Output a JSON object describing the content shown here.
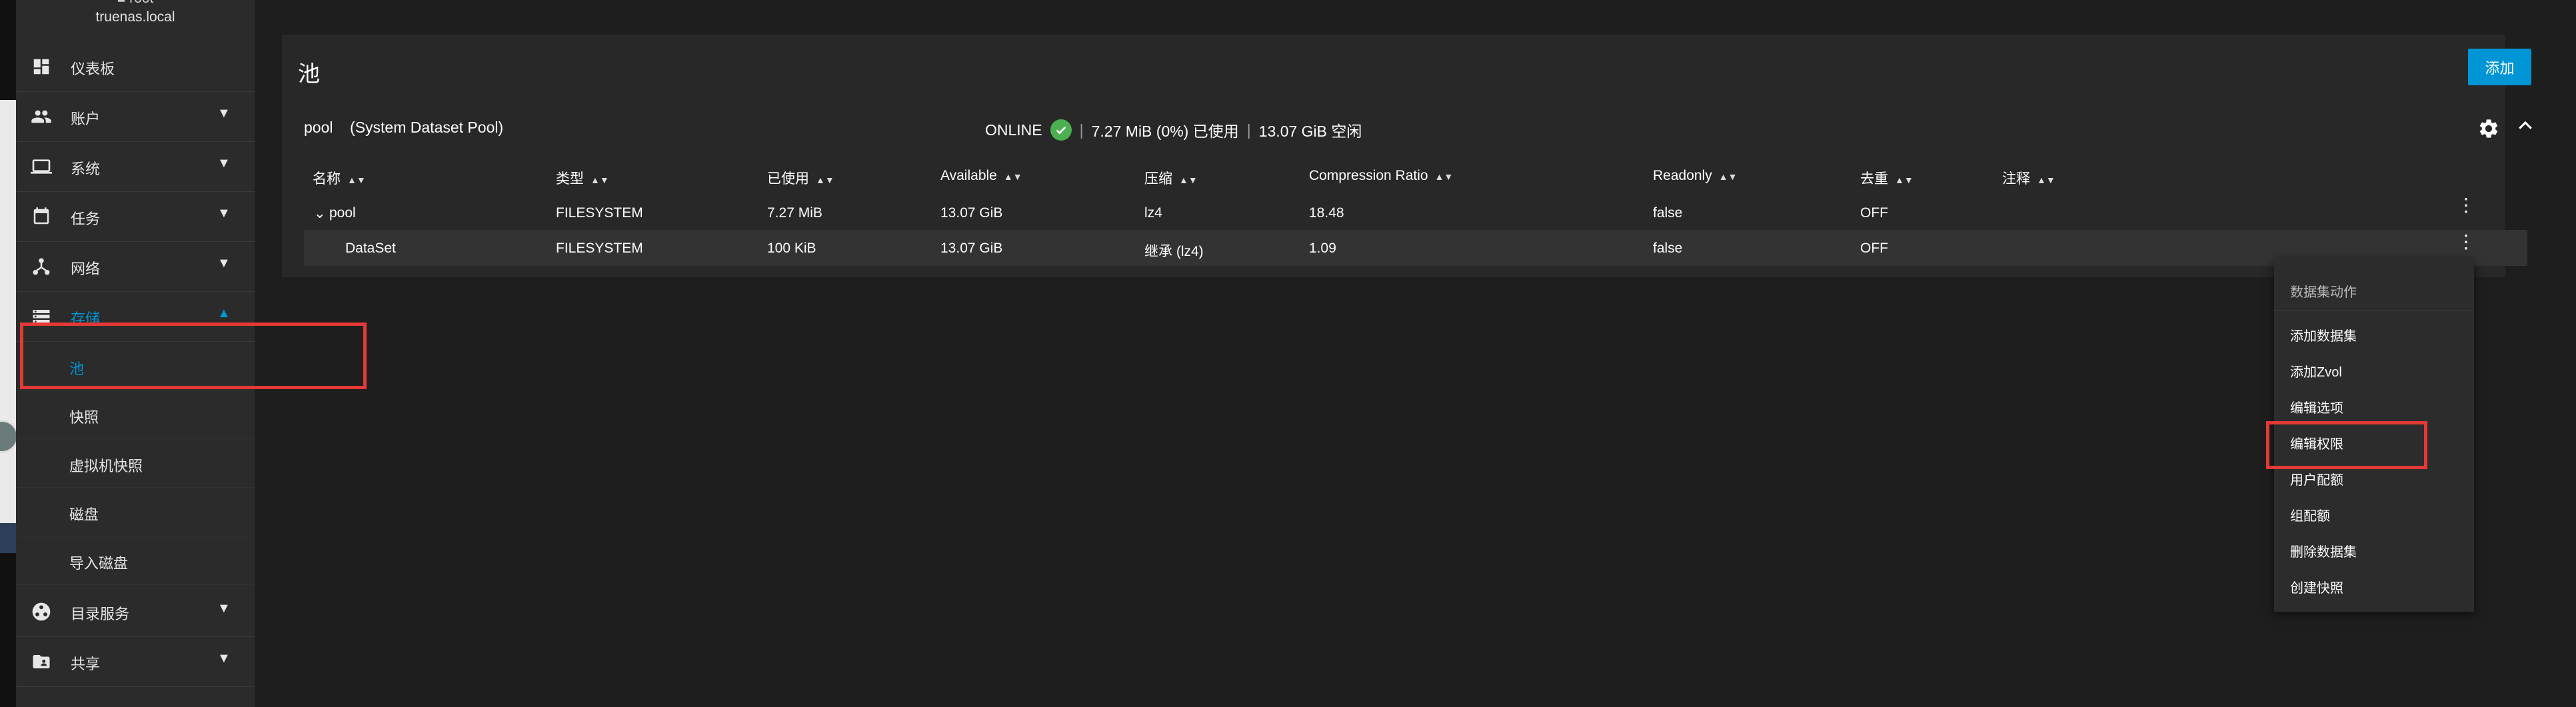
{
  "sidebar": {
    "user_line1": "■ root",
    "host": "truenas.local",
    "items": [
      {
        "label": "仪表板",
        "icon": "dashboard-icon"
      },
      {
        "label": "账户",
        "icon": "people-icon"
      },
      {
        "label": "系统",
        "icon": "laptop-icon"
      },
      {
        "label": "任务",
        "icon": "calendar-icon"
      },
      {
        "label": "网络",
        "icon": "network-icon"
      },
      {
        "label": "存储",
        "icon": "storage-icon"
      },
      {
        "label": "目录服务",
        "icon": "directory-icon"
      },
      {
        "label": "共享",
        "icon": "share-folder-icon"
      }
    ],
    "storage_sub": [
      "池",
      "快照",
      "虚拟机快照",
      "磁盘",
      "导入磁盘"
    ]
  },
  "main": {
    "title": "池",
    "add_label": "添加",
    "pool": {
      "name": "pool",
      "subtitle": "(System Dataset Pool)",
      "status": "ONLINE",
      "used": "7.27 MiB (0%) 已使用",
      "free": "13.07 GiB 空闲"
    },
    "columns": [
      "名称",
      "类型",
      "已使用",
      "Available",
      "压缩",
      "Compression Ratio",
      "Readonly",
      "去重",
      "注释"
    ],
    "rows": [
      {
        "name": "pool",
        "type": "FILESYSTEM",
        "used": "7.27 MiB",
        "available": "13.07 GiB",
        "compression": "lz4",
        "ratio": "18.48",
        "readonly": "false",
        "dedup": "OFF",
        "comment": ""
      },
      {
        "name": "DataSet",
        "type": "FILESYSTEM",
        "used": "100 KiB",
        "available": "13.07 GiB",
        "compression": "继承 (lz4)",
        "ratio": "1.09",
        "readonly": "false",
        "dedup": "OFF",
        "comment": ""
      }
    ]
  },
  "menu": {
    "header": "数据集动作",
    "items": [
      "添加数据集",
      "添加Zvol",
      "编辑选项",
      "编辑权限",
      "用户配额",
      "组配额",
      "删除数据集",
      "创建快照"
    ]
  },
  "colors": {
    "accent": "#0095d5",
    "highlight": "#e53935",
    "online": "#4caf50"
  }
}
